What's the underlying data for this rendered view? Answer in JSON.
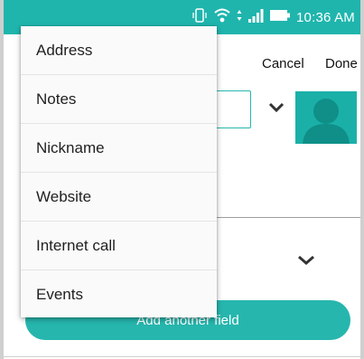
{
  "status_bar": {
    "time": "10:36 AM",
    "icons": [
      "vibrate-icon",
      "wifi-icon",
      "signal-icon",
      "battery-icon"
    ]
  },
  "form": {
    "cancel_label": "Cancel",
    "done_label": "Done",
    "add_field_label": "Add another field"
  },
  "menu": {
    "items": [
      "Address",
      "Notes",
      "Nickname",
      "Website",
      "Internet call",
      "Events"
    ]
  },
  "colors": {
    "accent": "#26b6ad",
    "status_bar": "#1fb5ad",
    "menu_background": "#fafafa"
  }
}
